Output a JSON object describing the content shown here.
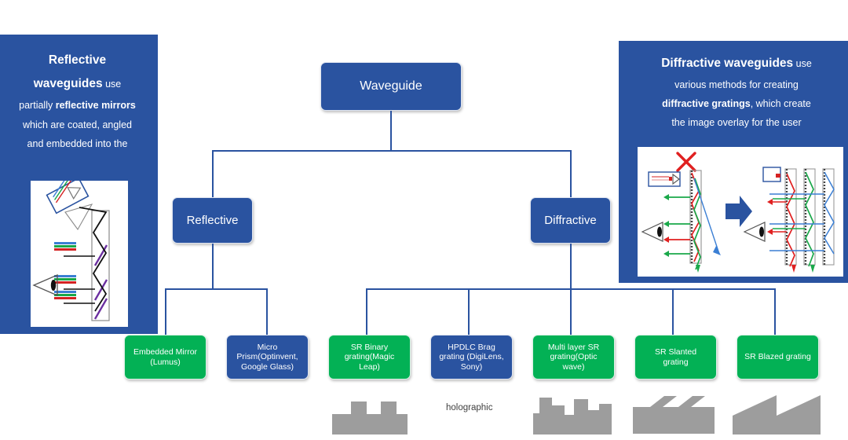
{
  "diagram": {
    "title": "Waveguide display technology taxonomy",
    "colors": {
      "blue": "#2a53a0",
      "green": "#03b155",
      "gray_glyph": "#9d9d9d",
      "white": "#ffffff"
    }
  },
  "panels": {
    "left": {
      "name": "reflective-waveguides-panel",
      "line1_bold": "Reflective",
      "line2_bold": "waveguides",
      "line2_rest": " use",
      "line3_pre": "partially ",
      "line3_bold": "reflective mirrors",
      "line4": "which are coated, angled",
      "line5": "and embedded into the",
      "figure_caption": "reflective-waveguide-ray-diagram"
    },
    "right": {
      "name": "diffractive-waveguides-panel",
      "line1_bold": "Diffractive waveguides",
      "line1_rest": " use",
      "line2": "various methods for creating",
      "line3_bold": "diffractive gratings",
      "line3_rest": ", which create",
      "line4": "the image overlay for the user",
      "figure_caption": "diffractive-waveguide-expansion-diagram"
    }
  },
  "tree": {
    "root": {
      "label": "Waveguide",
      "color": "blue"
    },
    "branches": [
      {
        "label": "Reflective",
        "color": "blue"
      },
      {
        "label": "Diffractive",
        "color": "blue"
      }
    ],
    "leaves": [
      {
        "label": "Embedded Mirror\n(Lumus)",
        "line1": "Embedded Mirror",
        "line2": "(Lumus)",
        "line3": "",
        "color": "green",
        "parent": "Reflective",
        "glyph": "none"
      },
      {
        "label": "Micro Prism(Optinvent, Google Glass)",
        "line1": "Micro",
        "line2": "Prism(Optinvent,",
        "line3": "Google Glass)",
        "color": "blue",
        "parent": "Reflective",
        "glyph": "none"
      },
      {
        "label": "SR Binary grating(Magic Leap)",
        "line1": "SR Binary",
        "line2": "grating(Magic",
        "line3": "Leap)",
        "color": "green",
        "parent": "Diffractive",
        "glyph": "binary"
      },
      {
        "label": "HPDLC Brag grating (DigiLens, Sony)",
        "line1": "HPDLC Brag",
        "line2": "grating (DigiLens,",
        "line3": "Sony)",
        "color": "blue",
        "parent": "Diffractive",
        "glyph": "holographic-text"
      },
      {
        "label": "Multi layer SR grating(Optic wave)",
        "line1": "Multi layer SR",
        "line2": "grating(Optic",
        "line3": "wave)",
        "color": "green",
        "parent": "Diffractive",
        "glyph": "multilayer"
      },
      {
        "label": "SR Slanted grating",
        "line1": "SR Slanted",
        "line2": "grating",
        "line3": "",
        "color": "green",
        "parent": "Diffractive",
        "glyph": "slanted"
      },
      {
        "label": "SR Blazed grating",
        "line1": "SR Blazed grating",
        "line2": "",
        "line3": "",
        "color": "green",
        "parent": "Diffractive",
        "glyph": "blazed"
      }
    ]
  },
  "captions": {
    "holographic": "holographic"
  }
}
